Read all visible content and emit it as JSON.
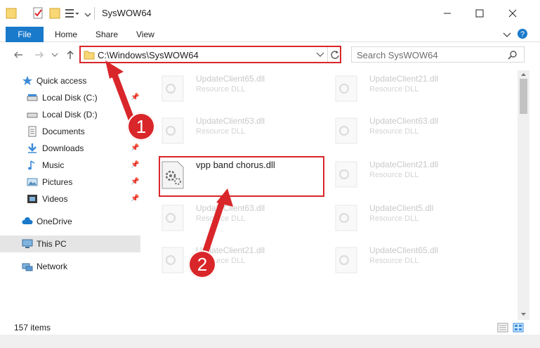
{
  "window": {
    "title": "SysWOW64",
    "minimize_icon": "minimize-icon",
    "maximize_icon": "maximize-icon",
    "close_icon": "close-icon"
  },
  "ribbon": {
    "tabs": [
      {
        "label": "File",
        "active": true
      },
      {
        "label": "Home"
      },
      {
        "label": "Share"
      },
      {
        "label": "View"
      }
    ]
  },
  "address": {
    "path": "C:\\Windows\\SysWOW64",
    "search_placeholder": "Search SysWOW64"
  },
  "nav": {
    "items": [
      {
        "label": "Quick access",
        "icon": "star-icon"
      },
      {
        "label": "Local Disk (C:)",
        "icon": "drive-icon",
        "pinned": true
      },
      {
        "label": "Local Disk (D:)",
        "icon": "drive-icon"
      },
      {
        "label": "Documents",
        "icon": "documents-icon"
      },
      {
        "label": "Downloads",
        "icon": "download-icon",
        "pinned": true
      },
      {
        "label": "Music",
        "icon": "music-icon",
        "pinned": true
      },
      {
        "label": "Pictures",
        "icon": "pictures-icon",
        "pinned": true
      },
      {
        "label": "Videos",
        "icon": "videos-icon",
        "pinned": true
      },
      {
        "label": "OneDrive",
        "icon": "cloud-icon"
      },
      {
        "label": "This PC",
        "icon": "pc-icon",
        "selected": true
      },
      {
        "label": "Network",
        "icon": "network-icon"
      }
    ]
  },
  "files": {
    "items": [
      {
        "name": "UpdateClient65.dll",
        "type": "Resource DLL"
      },
      {
        "name": "UpdateClient21.dll",
        "type": "Resource DLL"
      },
      {
        "name": "UpdateClient63.dll",
        "type": "Resource DLL"
      },
      {
        "name": "UpdateClient63.dll",
        "type": "Resource DLL"
      },
      {
        "name": "vpp band chorus.dll",
        "type": ""
      },
      {
        "name": "UpdateClient21.dll",
        "type": "Resource DLL"
      },
      {
        "name": "UpdateClient63.dll",
        "type": "Resource DLL"
      },
      {
        "name": "UpdateClient5.dll",
        "type": "Resource DLL"
      },
      {
        "name": "UpdateClient21.dll",
        "type": "Resource DLL"
      },
      {
        "name": "UpdateClient65.dll",
        "type": "Resource DLL"
      }
    ]
  },
  "status": {
    "count": "157 items"
  },
  "annotations": {
    "step1": "1",
    "step2": "2",
    "color": "#d9262a"
  }
}
